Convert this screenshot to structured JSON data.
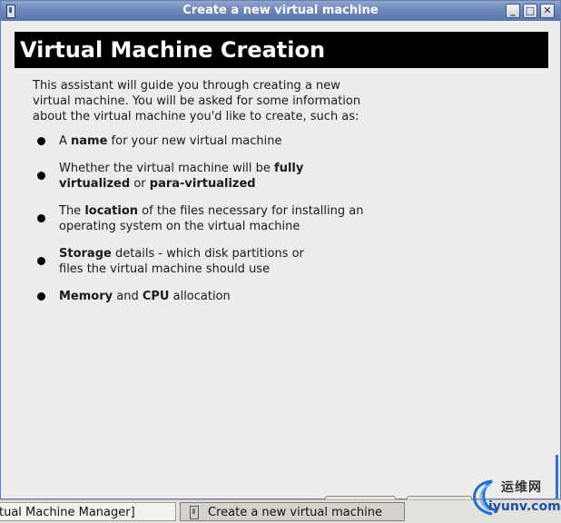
{
  "window": {
    "title": "Create a new virtual machine",
    "controls": {
      "minimize": "_",
      "maximize": "□",
      "close": "✕"
    }
  },
  "header": {
    "title": "Virtual Machine Creation"
  },
  "intro": {
    "text": "This assistant will guide you through creating a new virtual machine. You will be asked for some information about the virtual machine you'd like to create, such as:"
  },
  "bullets": [
    {
      "pre": "A ",
      "bold1": "name",
      "mid": " for your new virtual machine",
      "bold2": "",
      "post": ""
    },
    {
      "pre": "Whether the virtual machine will be ",
      "bold1": "fully virtualized",
      "mid": " or ",
      "bold2": "para-virtualized",
      "post": ""
    },
    {
      "pre": "The ",
      "bold1": "location",
      "mid": " of the files necessary for installing an operating system on the virtual machine",
      "bold2": "",
      "post": ""
    },
    {
      "pre": "",
      "bold1": "Storage",
      "mid": " details - which disk partitions or files the virtual machine should use",
      "bold2": "",
      "post": ""
    },
    {
      "pre": "",
      "bold1": "Memory",
      "mid": " and ",
      "bold2": "CPU",
      "post": " allocation"
    }
  ],
  "taskbar": {
    "items": [
      {
        "label": "tual Machine Manager]"
      },
      {
        "label": "Create a new virtual machine"
      }
    ]
  },
  "watermark": {
    "cn": "运维网",
    "en": "iyunv.com"
  },
  "icons": {
    "window_icon": "application-icon",
    "task_icon": "application-icon",
    "bullet": "bullet-dot-icon"
  },
  "colors": {
    "titlebar": "#6c87b9",
    "header_bg": "#000000",
    "window_bg": "#edeceb"
  }
}
